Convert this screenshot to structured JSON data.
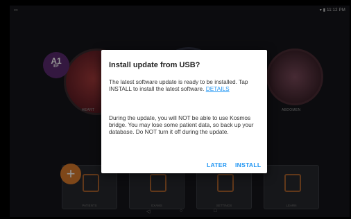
{
  "status_bar": {
    "left": "▭",
    "right": "▾ ▮ 11:12 PM"
  },
  "background": {
    "ef_badge": {
      "top": "A1",
      "bottom": "EF"
    },
    "tiles": [
      {
        "label": "HEART"
      },
      {
        "label": "ABDOMEN"
      }
    ],
    "cards": [
      {
        "label": "PATIENTS"
      },
      {
        "label": "EXAMS"
      },
      {
        "label": "SETTINGS"
      },
      {
        "label": "LEARN"
      }
    ],
    "fab": "+"
  },
  "nav_bar": {
    "back": "◁",
    "home": "○",
    "recents": "□"
  },
  "dialog": {
    "title": "Install update from USB?",
    "message_1": "The latest software update is ready to be installed. Tap INSTALL to install the latest software.",
    "details_link": "DETAILS",
    "message_2": "During the update, you will NOT be able to use Kosmos bridge. You may lose some patient data, so back up your database. Do NOT turn it off during the update.",
    "later_button": "LATER",
    "install_button": "INSTALL"
  },
  "colors": {
    "accent": "#2196f3",
    "fab": "#d97a2b",
    "ef_badge": "#5b2a6e"
  }
}
